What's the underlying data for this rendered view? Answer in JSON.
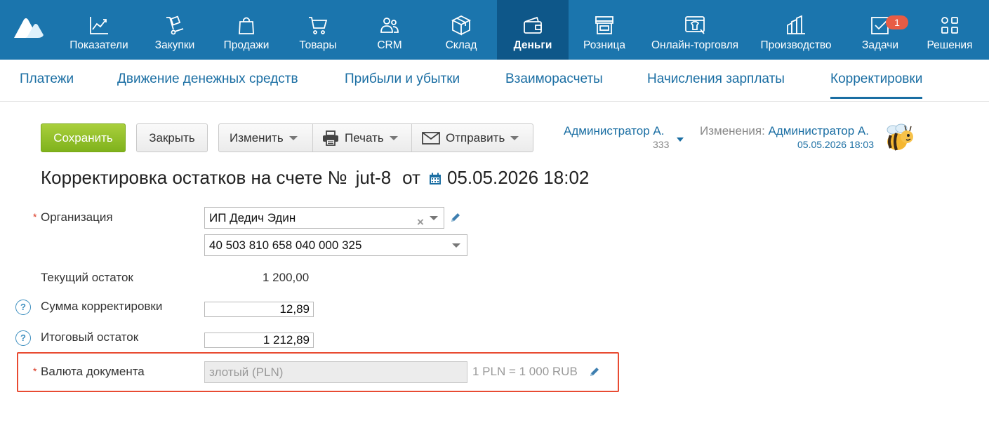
{
  "topnav": {
    "items": [
      {
        "label": "Показатели",
        "icon": "chart-line-icon"
      },
      {
        "label": "Закупки",
        "icon": "cart-dolly-icon"
      },
      {
        "label": "Продажи",
        "icon": "shopping-bag-icon"
      },
      {
        "label": "Товары",
        "icon": "shopping-cart-icon"
      },
      {
        "label": "CRM",
        "icon": "users-icon"
      },
      {
        "label": "Склад",
        "icon": "box-icon"
      },
      {
        "label": "Деньги",
        "icon": "wallet-icon"
      },
      {
        "label": "Розница",
        "icon": "store-icon"
      },
      {
        "label": "Онлайн-торговля",
        "icon": "online-shop-icon"
      },
      {
        "label": "Производство",
        "icon": "factory-icon"
      },
      {
        "label": "Задачи",
        "icon": "task-check-icon",
        "badge": "1"
      },
      {
        "label": "Решения",
        "icon": "apps-grid-icon"
      }
    ],
    "active": "Деньги"
  },
  "subnav": {
    "items": [
      "Платежи",
      "Движение денежных средств",
      "Прибыли и убытки",
      "Взаиморасчеты",
      "Начисления зарплаты",
      "Корректировки"
    ],
    "active": "Корректировки"
  },
  "toolbar": {
    "save": "Сохранить",
    "close": "Закрыть",
    "edit": "Изменить",
    "print": "Печать",
    "send": "Отправить"
  },
  "owner": {
    "name": "Администратор А.",
    "sub": "333"
  },
  "changes": {
    "label": "Изменения:",
    "user": "Администратор А.",
    "date": "05.05.2026 18:03"
  },
  "document": {
    "title": "Корректировка остатков на счете №",
    "number": "jut-8",
    "from": "от",
    "date": "05.05.2026 18:02"
  },
  "form": {
    "organization": {
      "label": "Организация",
      "value": "ИП Дедич Эдин"
    },
    "account": {
      "value": "40 503 810 658 040 000 325"
    },
    "current_balance": {
      "label": "Текущий остаток",
      "value": "1 200,00"
    },
    "correction_sum": {
      "label": "Сумма корректировки",
      "value": "12,89"
    },
    "final_balance": {
      "label": "Итоговый остаток",
      "value": "1 212,89"
    },
    "currency": {
      "label": "Валюта документа",
      "value": "злотый (PLN)",
      "rate": "1 PLN =  1 000 RUB"
    }
  },
  "colors": {
    "nav_bg": "#1b75ad",
    "nav_active": "#0e5789",
    "accent": "#1a6ea3",
    "save_green": "#8dbd24",
    "highlight": "#e84b32"
  }
}
